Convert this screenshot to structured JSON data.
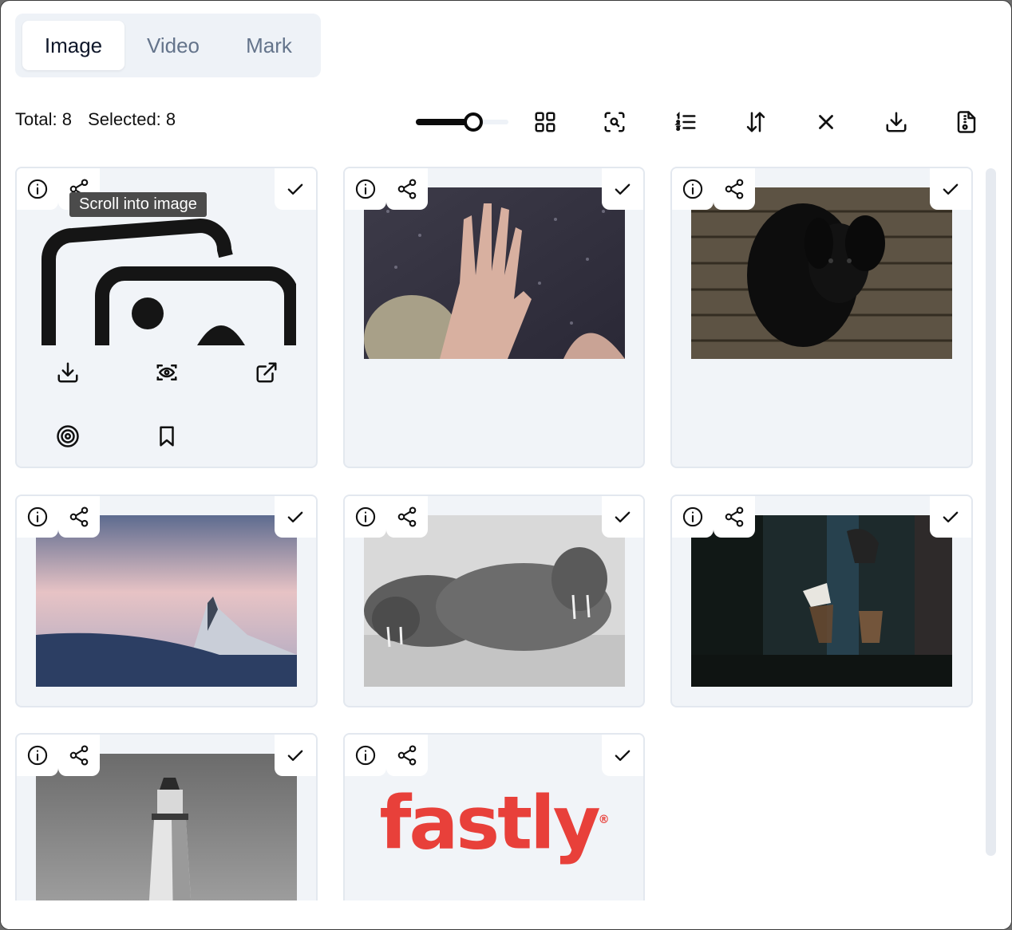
{
  "tabs": [
    {
      "label": "Image",
      "active": true
    },
    {
      "label": "Video",
      "active": false
    },
    {
      "label": "Mark",
      "active": false
    }
  ],
  "counts": {
    "total": "Total: 8",
    "selected": "Selected: 8"
  },
  "size_slider": {
    "value_fraction": 0.62
  },
  "toolbar_icons": [
    "grid-layout-icon",
    "scan-search-icon",
    "numbered-list-icon",
    "sort-icon",
    "close-icon",
    "download-icon",
    "file-export-icon"
  ],
  "tooltip": "Scroll into image",
  "cards": [
    {
      "image": "placeholder-images",
      "selected": true
    },
    {
      "image": "hand-on-rainy-window-photo",
      "selected": true
    },
    {
      "image": "black-puppy-on-wood-photo",
      "selected": true
    },
    {
      "image": "snowy-mountain-peak-photo",
      "selected": true
    },
    {
      "image": "walruses-on-beach-photo",
      "selected": true
    },
    {
      "image": "coffee-brewing-photo",
      "selected": true
    },
    {
      "image": "lighthouse-photo",
      "selected": true
    },
    {
      "image": "fastly-logo",
      "selected": true
    }
  ],
  "logo_text": "fastly",
  "logo_mark": "®",
  "colors": {
    "accent": "#0f172a",
    "muted": "#64748b",
    "card_bg": "#f1f4f8",
    "logo_red": "#e8403a"
  }
}
